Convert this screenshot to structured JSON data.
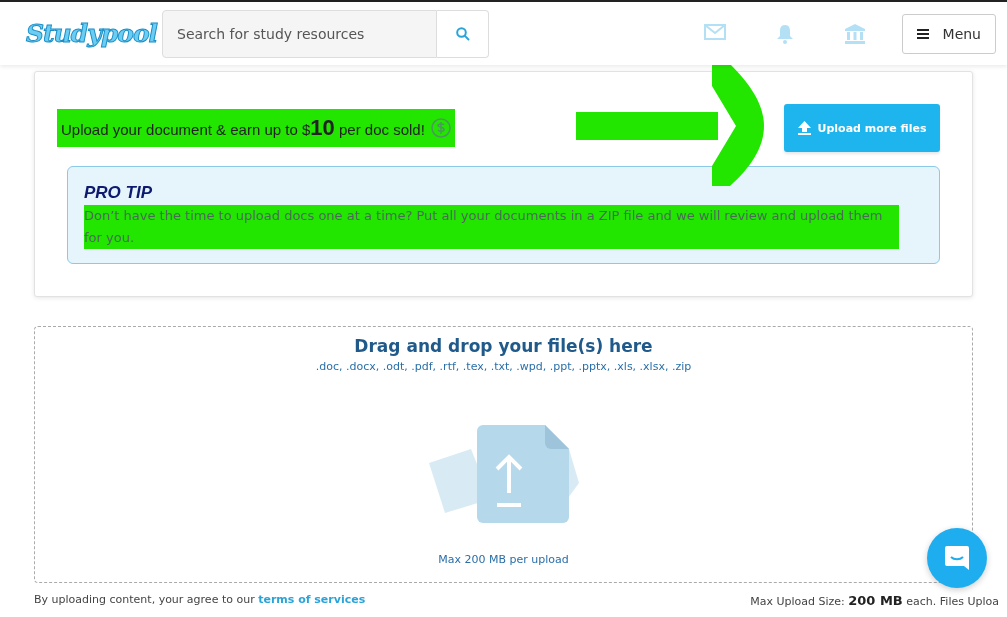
{
  "header": {
    "logo": "Studypool",
    "search": {
      "placeholder": "Search for study resources"
    },
    "menu_button": "Menu"
  },
  "upload_card": {
    "promo": "Upload your document & earn up to $**10** per doc sold!",
    "promo_highlighted": true,
    "upload_button": "Upload more files",
    "pro_tip": {
      "title": "PRO TIP",
      "text": "Don’t have the time to upload docs one at a time? Put all your documents in a ZIP file and we will review and upload them for you.",
      "highlighted": true
    }
  },
  "dropzone": {
    "title": "Drag and drop your file(s) here",
    "formats": ".doc, .docx, .odt, .pdf, .rtf, .tex, .txt, .wpd, .ppt, .pptx, .xls, .xlsx, .zip",
    "max_note": "Max 200 MB per upload"
  },
  "footer": {
    "agreement": "By uploading content, your agree to our",
    "terms_link": "terms of services",
    "limits": "Max Upload Size: **200 MB** each. Files Uploa"
  }
}
